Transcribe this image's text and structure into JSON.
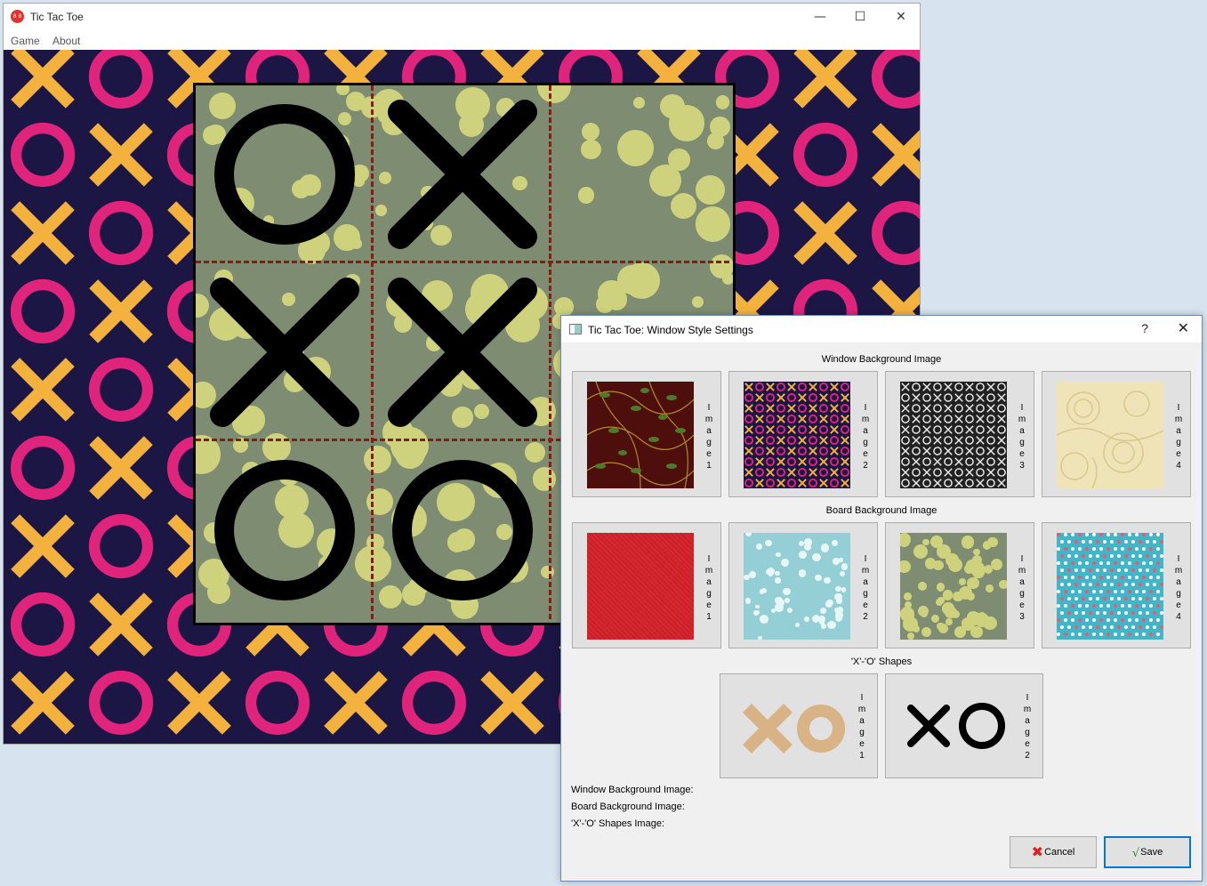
{
  "main_window": {
    "title": "Tic Tac Toe",
    "app_icon_text": "8 8",
    "menu": [
      "Game",
      "About"
    ],
    "board": [
      [
        "O",
        "X",
        ""
      ],
      [
        "X",
        "X",
        ""
      ],
      [
        "O",
        "O",
        ""
      ]
    ]
  },
  "dialog": {
    "title": "Tic Tac Toe: Window Style Settings",
    "help": "?",
    "sections": {
      "window_bg": "Window Background Image",
      "board_bg": "Board Background Image",
      "shapes": "'X'-'O' Shapes"
    },
    "window_bg_images": [
      "I\nm\na\ng\ne\n1",
      "I\nm\na\ng\ne\n2",
      "I\nm\na\ng\ne\n3",
      "I\nm\na\ng\ne\n4"
    ],
    "board_bg_images": [
      "I\nm\na\ng\ne\n1",
      "I\nm\na\ng\ne\n2",
      "I\nm\na\ng\ne\n3",
      "I\nm\na\ng\ne\n4"
    ],
    "shape_images": [
      "I\nm\na\ng\ne\n1",
      "I\nm\na\ng\ne\n2"
    ],
    "info": {
      "window_bg": "Window Background Image:",
      "board_bg": "Board Background Image:",
      "shapes": "'X'-'O' Shapes Image:"
    },
    "buttons": {
      "cancel": "Cancel",
      "save": "Save"
    }
  },
  "colors": {
    "bg_navy": "#1c1645",
    "x_orange": "#f3b23e",
    "o_pink": "#e0237b",
    "board_green": "#7e8d72",
    "blob_yellow": "#cfd27c",
    "grid_red": "#8a1a14",
    "accent": "#0078d7"
  },
  "icons": [
    "app-icon",
    "minimize-icon",
    "maximize-icon",
    "close-icon",
    "help-icon",
    "cancel-x-icon",
    "save-check-icon"
  ]
}
